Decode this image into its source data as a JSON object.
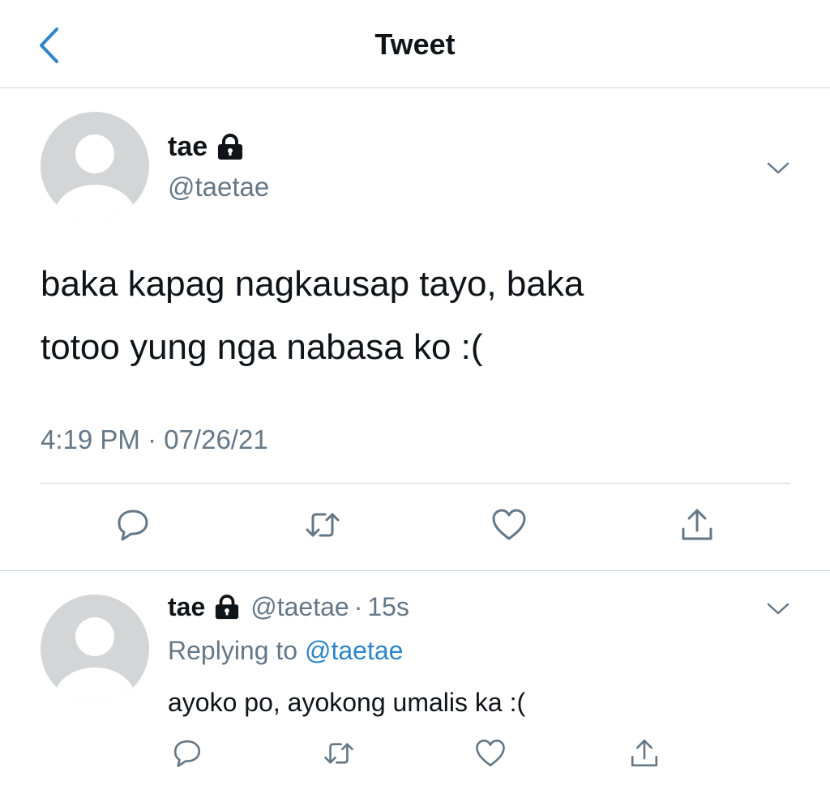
{
  "header": {
    "title": "Tweet",
    "back_icon": "chevron-left-icon"
  },
  "colors": {
    "accent": "#2e86c9",
    "secondary_text": "#657786",
    "divider": "#cfd5da",
    "avatar_bg": "#d3d5d6"
  },
  "tweet": {
    "name": "tae",
    "handle": "@taetae",
    "text_line1": "baka kapag nagkausap tayo, baka",
    "text_line2": "totoo yung nga nabasa ko :(",
    "timestamp": "4:19 PM · 07/26/21",
    "icons": {
      "protected": "lock-icon",
      "more": "chevron-down-icon",
      "reply": "reply-icon",
      "retweet": "retweet-icon",
      "like": "heart-icon",
      "share": "share-icon"
    }
  },
  "reply": {
    "name": "tae",
    "handle": "@taetae",
    "separator": "·",
    "time": "15s",
    "replying_prefix": "Replying to",
    "replying_handle": "@taetae",
    "text": "ayoko po, ayokong umalis ka :("
  }
}
